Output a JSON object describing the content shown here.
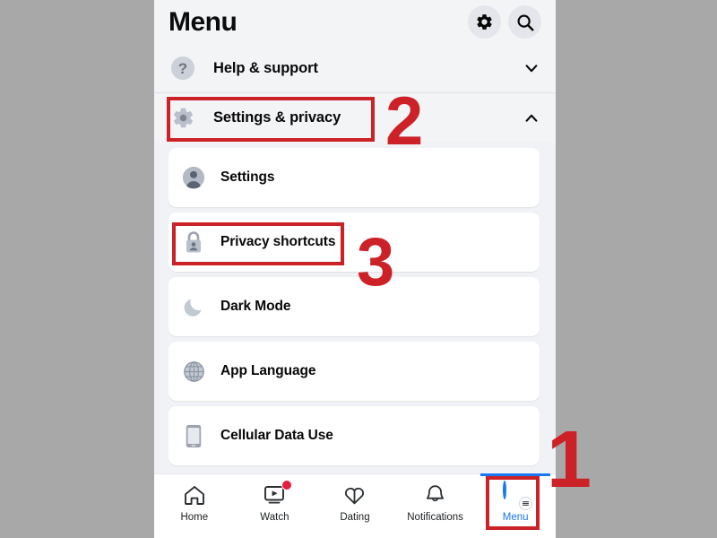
{
  "app": {
    "title": "Menu",
    "header_icons": [
      {
        "name": "gear-icon",
        "label": "Settings"
      },
      {
        "name": "search-icon",
        "label": "Search"
      }
    ]
  },
  "menu": {
    "collapsible_sections": [
      {
        "id": "help-support",
        "label": "Help & support",
        "icon": "question-mark-circle-icon",
        "expanded": false,
        "chevron": "chevron-down-icon"
      },
      {
        "id": "settings-privacy",
        "label": "Settings & privacy",
        "icon": "gear-icon",
        "expanded": true,
        "chevron": "chevron-up-icon"
      }
    ],
    "items": [
      {
        "id": "settings",
        "label": "Settings",
        "icon": "person-circle-icon"
      },
      {
        "id": "privacy-shortcuts",
        "label": "Privacy shortcuts",
        "icon": "lock-person-icon"
      },
      {
        "id": "dark-mode",
        "label": "Dark Mode",
        "icon": "moon-icon"
      },
      {
        "id": "app-language",
        "label": "App Language",
        "icon": "globe-icon"
      },
      {
        "id": "cellular-data-use",
        "label": "Cellular Data Use",
        "icon": "mobile-phone-icon"
      }
    ]
  },
  "bottom_nav": {
    "items": [
      {
        "id": "home",
        "label": "Home",
        "icon": "home-icon",
        "active": false,
        "badge": false
      },
      {
        "id": "watch",
        "label": "Watch",
        "icon": "watch-video-icon",
        "active": false,
        "badge": true
      },
      {
        "id": "dating",
        "label": "Dating",
        "icon": "dating-hearts-icon",
        "active": false,
        "badge": false
      },
      {
        "id": "notifications",
        "label": "Notifications",
        "icon": "bell-icon",
        "active": false,
        "badge": false
      },
      {
        "id": "menu",
        "label": "Menu",
        "icon": "avatar-menu-icon",
        "active": true,
        "badge": false
      }
    ],
    "active_color": "#1877f2"
  },
  "annotations": {
    "color": "#cc2127",
    "steps": [
      {
        "number": "1",
        "target": "menu-tab"
      },
      {
        "number": "2",
        "target": "settings-privacy-row"
      },
      {
        "number": "3",
        "target": "privacy-shortcuts-item"
      }
    ]
  },
  "colors": {
    "background": "#a8a8a8",
    "phone_bg": "#f0f2f5",
    "header_bg": "#f3f4f6",
    "card_bg": "#ffffff",
    "accent_blue": "#1877f2",
    "annotation_red": "#cc2127",
    "badge_red": "#e41e3f"
  }
}
